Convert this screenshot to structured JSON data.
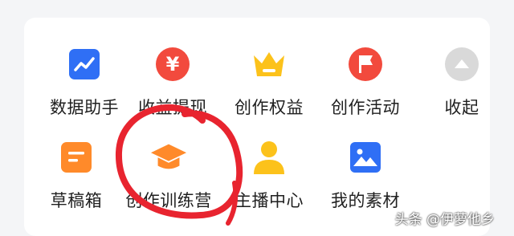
{
  "grid": {
    "row1": [
      {
        "label": "数据助手",
        "icon": "trend-chart-icon",
        "color": "#2f6ff5"
      },
      {
        "label": "收益提现",
        "icon": "yen-icon",
        "color": "#f24a3d"
      },
      {
        "label": "创作权益",
        "icon": "crown-icon",
        "color": "#fcc21b"
      },
      {
        "label": "创作活动",
        "icon": "flag-icon",
        "color": "#f24a3d"
      },
      {
        "label": "收起",
        "icon": "collapse-up-icon",
        "color": "#d9d9d9"
      }
    ],
    "row2": [
      {
        "label": "草稿箱",
        "icon": "draft-icon",
        "color": "#ff8a2a"
      },
      {
        "label": "创作训练营",
        "icon": "graduation-cap-icon",
        "color": "#ff8a2a"
      },
      {
        "label": "主播中心",
        "icon": "person-icon",
        "color": "#fcc21b"
      },
      {
        "label": "我的素材",
        "icon": "image-icon",
        "color": "#2f6ff5"
      }
    ]
  },
  "annotation": {
    "color": "#e8242f"
  },
  "watermark": "头条 @伊萝他乡"
}
